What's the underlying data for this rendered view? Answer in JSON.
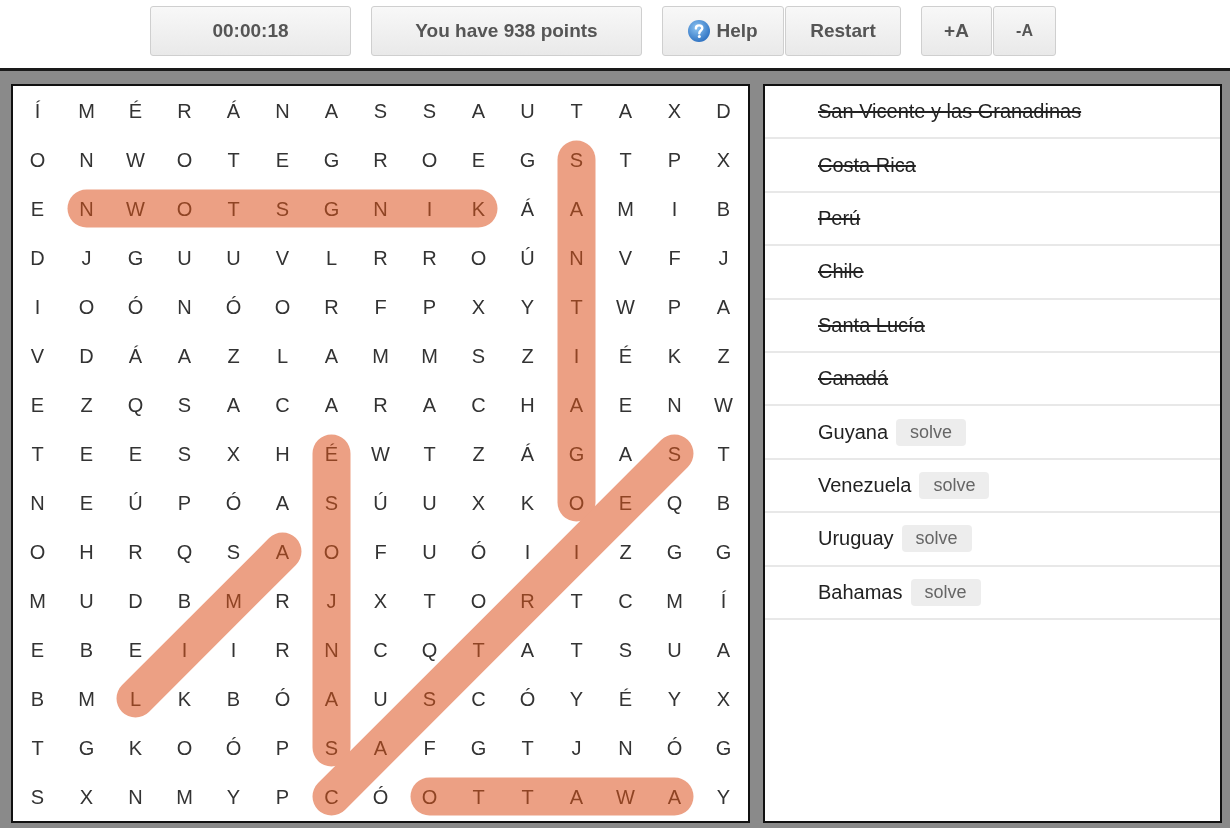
{
  "toolbar": {
    "groups": [
      {
        "buttons": [
          {
            "kind": "timer",
            "label": "00:00:18"
          }
        ]
      },
      {
        "buttons": [
          {
            "kind": "score",
            "label": "You have 938 points"
          }
        ]
      },
      {
        "buttons": [
          {
            "kind": "help",
            "label": "Help"
          },
          {
            "kind": "restart",
            "label": "Restart"
          }
        ]
      },
      {
        "buttons": [
          {
            "kind": "font-up",
            "label": "+A"
          },
          {
            "kind": "font-down",
            "label": "-A"
          }
        ]
      }
    ]
  },
  "grid": {
    "rows": [
      {
        "cells": [
          {
            "letter": "Í",
            "kind": "plain"
          },
          {
            "letter": "M",
            "kind": "plain"
          },
          {
            "letter": "É",
            "kind": "plain"
          },
          {
            "letter": "R",
            "kind": "plain"
          },
          {
            "letter": "Á",
            "kind": "plain"
          },
          {
            "letter": "N",
            "kind": "plain"
          },
          {
            "letter": "A",
            "kind": "plain"
          },
          {
            "letter": "S",
            "kind": "plain"
          },
          {
            "letter": "S",
            "kind": "plain"
          },
          {
            "letter": "A",
            "kind": "plain"
          },
          {
            "letter": "U",
            "kind": "plain"
          },
          {
            "letter": "T",
            "kind": "plain"
          },
          {
            "letter": "A",
            "kind": "plain"
          },
          {
            "letter": "X",
            "kind": "plain"
          },
          {
            "letter": "D",
            "kind": "plain"
          }
        ]
      },
      {
        "cells": [
          {
            "letter": "O",
            "kind": "plain"
          },
          {
            "letter": "N",
            "kind": "plain"
          },
          {
            "letter": "W",
            "kind": "plain"
          },
          {
            "letter": "O",
            "kind": "plain"
          },
          {
            "letter": "T",
            "kind": "plain"
          },
          {
            "letter": "E",
            "kind": "plain"
          },
          {
            "letter": "G",
            "kind": "plain"
          },
          {
            "letter": "R",
            "kind": "plain"
          },
          {
            "letter": "O",
            "kind": "plain"
          },
          {
            "letter": "E",
            "kind": "plain"
          },
          {
            "letter": "G",
            "kind": "plain"
          },
          {
            "letter": "S",
            "kind": "vertical"
          },
          {
            "letter": "T",
            "kind": "plain"
          },
          {
            "letter": "P",
            "kind": "plain"
          },
          {
            "letter": "X",
            "kind": "plain"
          }
        ]
      },
      {
        "cells": [
          {
            "letter": "E",
            "kind": "plain"
          },
          {
            "letter": "N",
            "kind": "horizontal"
          },
          {
            "letter": "W",
            "kind": "horizontal"
          },
          {
            "letter": "O",
            "kind": "horizontal"
          },
          {
            "letter": "T",
            "kind": "horizontal"
          },
          {
            "letter": "S",
            "kind": "horizontal"
          },
          {
            "letter": "G",
            "kind": "horizontal"
          },
          {
            "letter": "N",
            "kind": "horizontal"
          },
          {
            "letter": "I",
            "kind": "horizontal"
          },
          {
            "letter": "K",
            "kind": "horizontal"
          },
          {
            "letter": "Á",
            "kind": "plain"
          },
          {
            "letter": "A",
            "kind": "vertical"
          },
          {
            "letter": "M",
            "kind": "plain"
          },
          {
            "letter": "I",
            "kind": "plain"
          },
          {
            "letter": "B",
            "kind": "plain"
          }
        ]
      },
      {
        "cells": [
          {
            "letter": "D",
            "kind": "plain"
          },
          {
            "letter": "J",
            "kind": "plain"
          },
          {
            "letter": "G",
            "kind": "plain"
          },
          {
            "letter": "U",
            "kind": "plain"
          },
          {
            "letter": "U",
            "kind": "plain"
          },
          {
            "letter": "V",
            "kind": "plain"
          },
          {
            "letter": "L",
            "kind": "plain"
          },
          {
            "letter": "R",
            "kind": "plain"
          },
          {
            "letter": "R",
            "kind": "plain"
          },
          {
            "letter": "O",
            "kind": "plain"
          },
          {
            "letter": "Ú",
            "kind": "plain"
          },
          {
            "letter": "N",
            "kind": "vertical"
          },
          {
            "letter": "V",
            "kind": "plain"
          },
          {
            "letter": "F",
            "kind": "plain"
          },
          {
            "letter": "J",
            "kind": "plain"
          }
        ]
      },
      {
        "cells": [
          {
            "letter": "I",
            "kind": "plain"
          },
          {
            "letter": "O",
            "kind": "plain"
          },
          {
            "letter": "Ó",
            "kind": "plain"
          },
          {
            "letter": "N",
            "kind": "plain"
          },
          {
            "letter": "Ó",
            "kind": "plain"
          },
          {
            "letter": "O",
            "kind": "plain"
          },
          {
            "letter": "R",
            "kind": "plain"
          },
          {
            "letter": "F",
            "kind": "plain"
          },
          {
            "letter": "P",
            "kind": "plain"
          },
          {
            "letter": "X",
            "kind": "plain"
          },
          {
            "letter": "Y",
            "kind": "plain"
          },
          {
            "letter": "T",
            "kind": "vertical"
          },
          {
            "letter": "W",
            "kind": "plain"
          },
          {
            "letter": "P",
            "kind": "plain"
          },
          {
            "letter": "A",
            "kind": "plain"
          }
        ]
      },
      {
        "cells": [
          {
            "letter": "V",
            "kind": "plain"
          },
          {
            "letter": "D",
            "kind": "plain"
          },
          {
            "letter": "Á",
            "kind": "plain"
          },
          {
            "letter": "A",
            "kind": "plain"
          },
          {
            "letter": "Z",
            "kind": "plain"
          },
          {
            "letter": "L",
            "kind": "plain"
          },
          {
            "letter": "A",
            "kind": "plain"
          },
          {
            "letter": "M",
            "kind": "plain"
          },
          {
            "letter": "M",
            "kind": "plain"
          },
          {
            "letter": "S",
            "kind": "plain"
          },
          {
            "letter": "Z",
            "kind": "plain"
          },
          {
            "letter": "I",
            "kind": "vertical"
          },
          {
            "letter": "É",
            "kind": "plain"
          },
          {
            "letter": "K",
            "kind": "plain"
          },
          {
            "letter": "Z",
            "kind": "plain"
          }
        ]
      },
      {
        "cells": [
          {
            "letter": "E",
            "kind": "plain"
          },
          {
            "letter": "Z",
            "kind": "plain"
          },
          {
            "letter": "Q",
            "kind": "plain"
          },
          {
            "letter": "S",
            "kind": "plain"
          },
          {
            "letter": "A",
            "kind": "plain"
          },
          {
            "letter": "C",
            "kind": "plain"
          },
          {
            "letter": "A",
            "kind": "plain"
          },
          {
            "letter": "R",
            "kind": "plain"
          },
          {
            "letter": "A",
            "kind": "plain"
          },
          {
            "letter": "C",
            "kind": "plain"
          },
          {
            "letter": "H",
            "kind": "plain"
          },
          {
            "letter": "A",
            "kind": "vertical"
          },
          {
            "letter": "E",
            "kind": "plain"
          },
          {
            "letter": "N",
            "kind": "plain"
          },
          {
            "letter": "W",
            "kind": "plain"
          }
        ]
      },
      {
        "cells": [
          {
            "letter": "T",
            "kind": "plain"
          },
          {
            "letter": "E",
            "kind": "plain"
          },
          {
            "letter": "E",
            "kind": "plain"
          },
          {
            "letter": "S",
            "kind": "plain"
          },
          {
            "letter": "X",
            "kind": "plain"
          },
          {
            "letter": "H",
            "kind": "plain"
          },
          {
            "letter": "É",
            "kind": "vertical"
          },
          {
            "letter": "W",
            "kind": "plain"
          },
          {
            "letter": "T",
            "kind": "plain"
          },
          {
            "letter": "Z",
            "kind": "plain"
          },
          {
            "letter": "Á",
            "kind": "plain"
          },
          {
            "letter": "G",
            "kind": "vertical"
          },
          {
            "letter": "A",
            "kind": "plain"
          },
          {
            "letter": "S",
            "kind": "rising"
          },
          {
            "letter": "T",
            "kind": "plain"
          }
        ]
      },
      {
        "cells": [
          {
            "letter": "N",
            "kind": "plain"
          },
          {
            "letter": "E",
            "kind": "plain"
          },
          {
            "letter": "Ú",
            "kind": "plain"
          },
          {
            "letter": "P",
            "kind": "plain"
          },
          {
            "letter": "Ó",
            "kind": "plain"
          },
          {
            "letter": "A",
            "kind": "plain"
          },
          {
            "letter": "S",
            "kind": "vertical"
          },
          {
            "letter": "Ú",
            "kind": "plain"
          },
          {
            "letter": "U",
            "kind": "plain"
          },
          {
            "letter": "X",
            "kind": "plain"
          },
          {
            "letter": "K",
            "kind": "plain"
          },
          {
            "letter": "O",
            "kind": "vertical"
          },
          {
            "letter": "E",
            "kind": "rising"
          },
          {
            "letter": "Q",
            "kind": "plain"
          },
          {
            "letter": "B",
            "kind": "plain"
          }
        ]
      },
      {
        "cells": [
          {
            "letter": "O",
            "kind": "plain"
          },
          {
            "letter": "H",
            "kind": "plain"
          },
          {
            "letter": "R",
            "kind": "plain"
          },
          {
            "letter": "Q",
            "kind": "plain"
          },
          {
            "letter": "S",
            "kind": "plain"
          },
          {
            "letter": "A",
            "kind": "rising"
          },
          {
            "letter": "O",
            "kind": "vertical"
          },
          {
            "letter": "F",
            "kind": "plain"
          },
          {
            "letter": "U",
            "kind": "plain"
          },
          {
            "letter": "Ó",
            "kind": "plain"
          },
          {
            "letter": "I",
            "kind": "plain"
          },
          {
            "letter": "I",
            "kind": "rising"
          },
          {
            "letter": "Z",
            "kind": "plain"
          },
          {
            "letter": "G",
            "kind": "plain"
          },
          {
            "letter": "G",
            "kind": "plain"
          }
        ]
      },
      {
        "cells": [
          {
            "letter": "M",
            "kind": "plain"
          },
          {
            "letter": "U",
            "kind": "plain"
          },
          {
            "letter": "D",
            "kind": "plain"
          },
          {
            "letter": "B",
            "kind": "plain"
          },
          {
            "letter": "M",
            "kind": "rising"
          },
          {
            "letter": "R",
            "kind": "plain"
          },
          {
            "letter": "J",
            "kind": "vertical"
          },
          {
            "letter": "X",
            "kind": "plain"
          },
          {
            "letter": "T",
            "kind": "plain"
          },
          {
            "letter": "O",
            "kind": "plain"
          },
          {
            "letter": "R",
            "kind": "rising"
          },
          {
            "letter": "T",
            "kind": "plain"
          },
          {
            "letter": "C",
            "kind": "plain"
          },
          {
            "letter": "M",
            "kind": "plain"
          },
          {
            "letter": "Í",
            "kind": "plain"
          }
        ]
      },
      {
        "cells": [
          {
            "letter": "E",
            "kind": "plain"
          },
          {
            "letter": "B",
            "kind": "plain"
          },
          {
            "letter": "E",
            "kind": "plain"
          },
          {
            "letter": "I",
            "kind": "rising"
          },
          {
            "letter": "I",
            "kind": "plain"
          },
          {
            "letter": "R",
            "kind": "plain"
          },
          {
            "letter": "N",
            "kind": "vertical"
          },
          {
            "letter": "C",
            "kind": "plain"
          },
          {
            "letter": "Q",
            "kind": "plain"
          },
          {
            "letter": "T",
            "kind": "rising"
          },
          {
            "letter": "A",
            "kind": "plain"
          },
          {
            "letter": "T",
            "kind": "plain"
          },
          {
            "letter": "S",
            "kind": "plain"
          },
          {
            "letter": "U",
            "kind": "plain"
          },
          {
            "letter": "A",
            "kind": "plain"
          }
        ]
      },
      {
        "cells": [
          {
            "letter": "B",
            "kind": "plain"
          },
          {
            "letter": "M",
            "kind": "plain"
          },
          {
            "letter": "L",
            "kind": "rising"
          },
          {
            "letter": "K",
            "kind": "plain"
          },
          {
            "letter": "B",
            "kind": "plain"
          },
          {
            "letter": "Ó",
            "kind": "plain"
          },
          {
            "letter": "A",
            "kind": "vertical"
          },
          {
            "letter": "U",
            "kind": "plain"
          },
          {
            "letter": "S",
            "kind": "rising"
          },
          {
            "letter": "C",
            "kind": "plain"
          },
          {
            "letter": "Ó",
            "kind": "plain"
          },
          {
            "letter": "Y",
            "kind": "plain"
          },
          {
            "letter": "É",
            "kind": "plain"
          },
          {
            "letter": "Y",
            "kind": "plain"
          },
          {
            "letter": "X",
            "kind": "plain"
          }
        ]
      },
      {
        "cells": [
          {
            "letter": "T",
            "kind": "plain"
          },
          {
            "letter": "G",
            "kind": "plain"
          },
          {
            "letter": "K",
            "kind": "plain"
          },
          {
            "letter": "O",
            "kind": "plain"
          },
          {
            "letter": "Ó",
            "kind": "plain"
          },
          {
            "letter": "P",
            "kind": "plain"
          },
          {
            "letter": "S",
            "kind": "vertical"
          },
          {
            "letter": "A",
            "kind": "rising"
          },
          {
            "letter": "F",
            "kind": "plain"
          },
          {
            "letter": "G",
            "kind": "plain"
          },
          {
            "letter": "T",
            "kind": "plain"
          },
          {
            "letter": "J",
            "kind": "plain"
          },
          {
            "letter": "N",
            "kind": "plain"
          },
          {
            "letter": "Ó",
            "kind": "plain"
          },
          {
            "letter": "G",
            "kind": "plain"
          }
        ]
      },
      {
        "cells": [
          {
            "letter": "S",
            "kind": "plain"
          },
          {
            "letter": "X",
            "kind": "plain"
          },
          {
            "letter": "N",
            "kind": "plain"
          },
          {
            "letter": "M",
            "kind": "plain"
          },
          {
            "letter": "Y",
            "kind": "plain"
          },
          {
            "letter": "P",
            "kind": "plain"
          },
          {
            "letter": "C",
            "kind": "rising"
          },
          {
            "letter": "Ó",
            "kind": "plain"
          },
          {
            "letter": "O",
            "kind": "horizontal"
          },
          {
            "letter": "T",
            "kind": "horizontal"
          },
          {
            "letter": "T",
            "kind": "horizontal"
          },
          {
            "letter": "A",
            "kind": "horizontal"
          },
          {
            "letter": "W",
            "kind": "horizontal"
          },
          {
            "letter": "A",
            "kind": "horizontal"
          },
          {
            "letter": "Y",
            "kind": "plain"
          }
        ]
      }
    ]
  },
  "word_list": {
    "items": [
      {
        "label": "San Vicente y las Granadinas",
        "found": true
      },
      {
        "label": "Costa Rica",
        "found": true
      },
      {
        "label": "Perú",
        "found": true
      },
      {
        "label": "Chile",
        "found": true
      },
      {
        "label": "Santa Lucía",
        "found": true
      },
      {
        "label": "Canadá",
        "found": true
      },
      {
        "label": "Guyana",
        "found": false,
        "solve_label": "solve"
      },
      {
        "label": "Venezuela",
        "found": false,
        "solve_label": "solve"
      },
      {
        "label": "Uruguay",
        "found": false,
        "solve_label": "solve"
      },
      {
        "label": "Bahamas",
        "found": false,
        "solve_label": "solve"
      }
    ]
  }
}
